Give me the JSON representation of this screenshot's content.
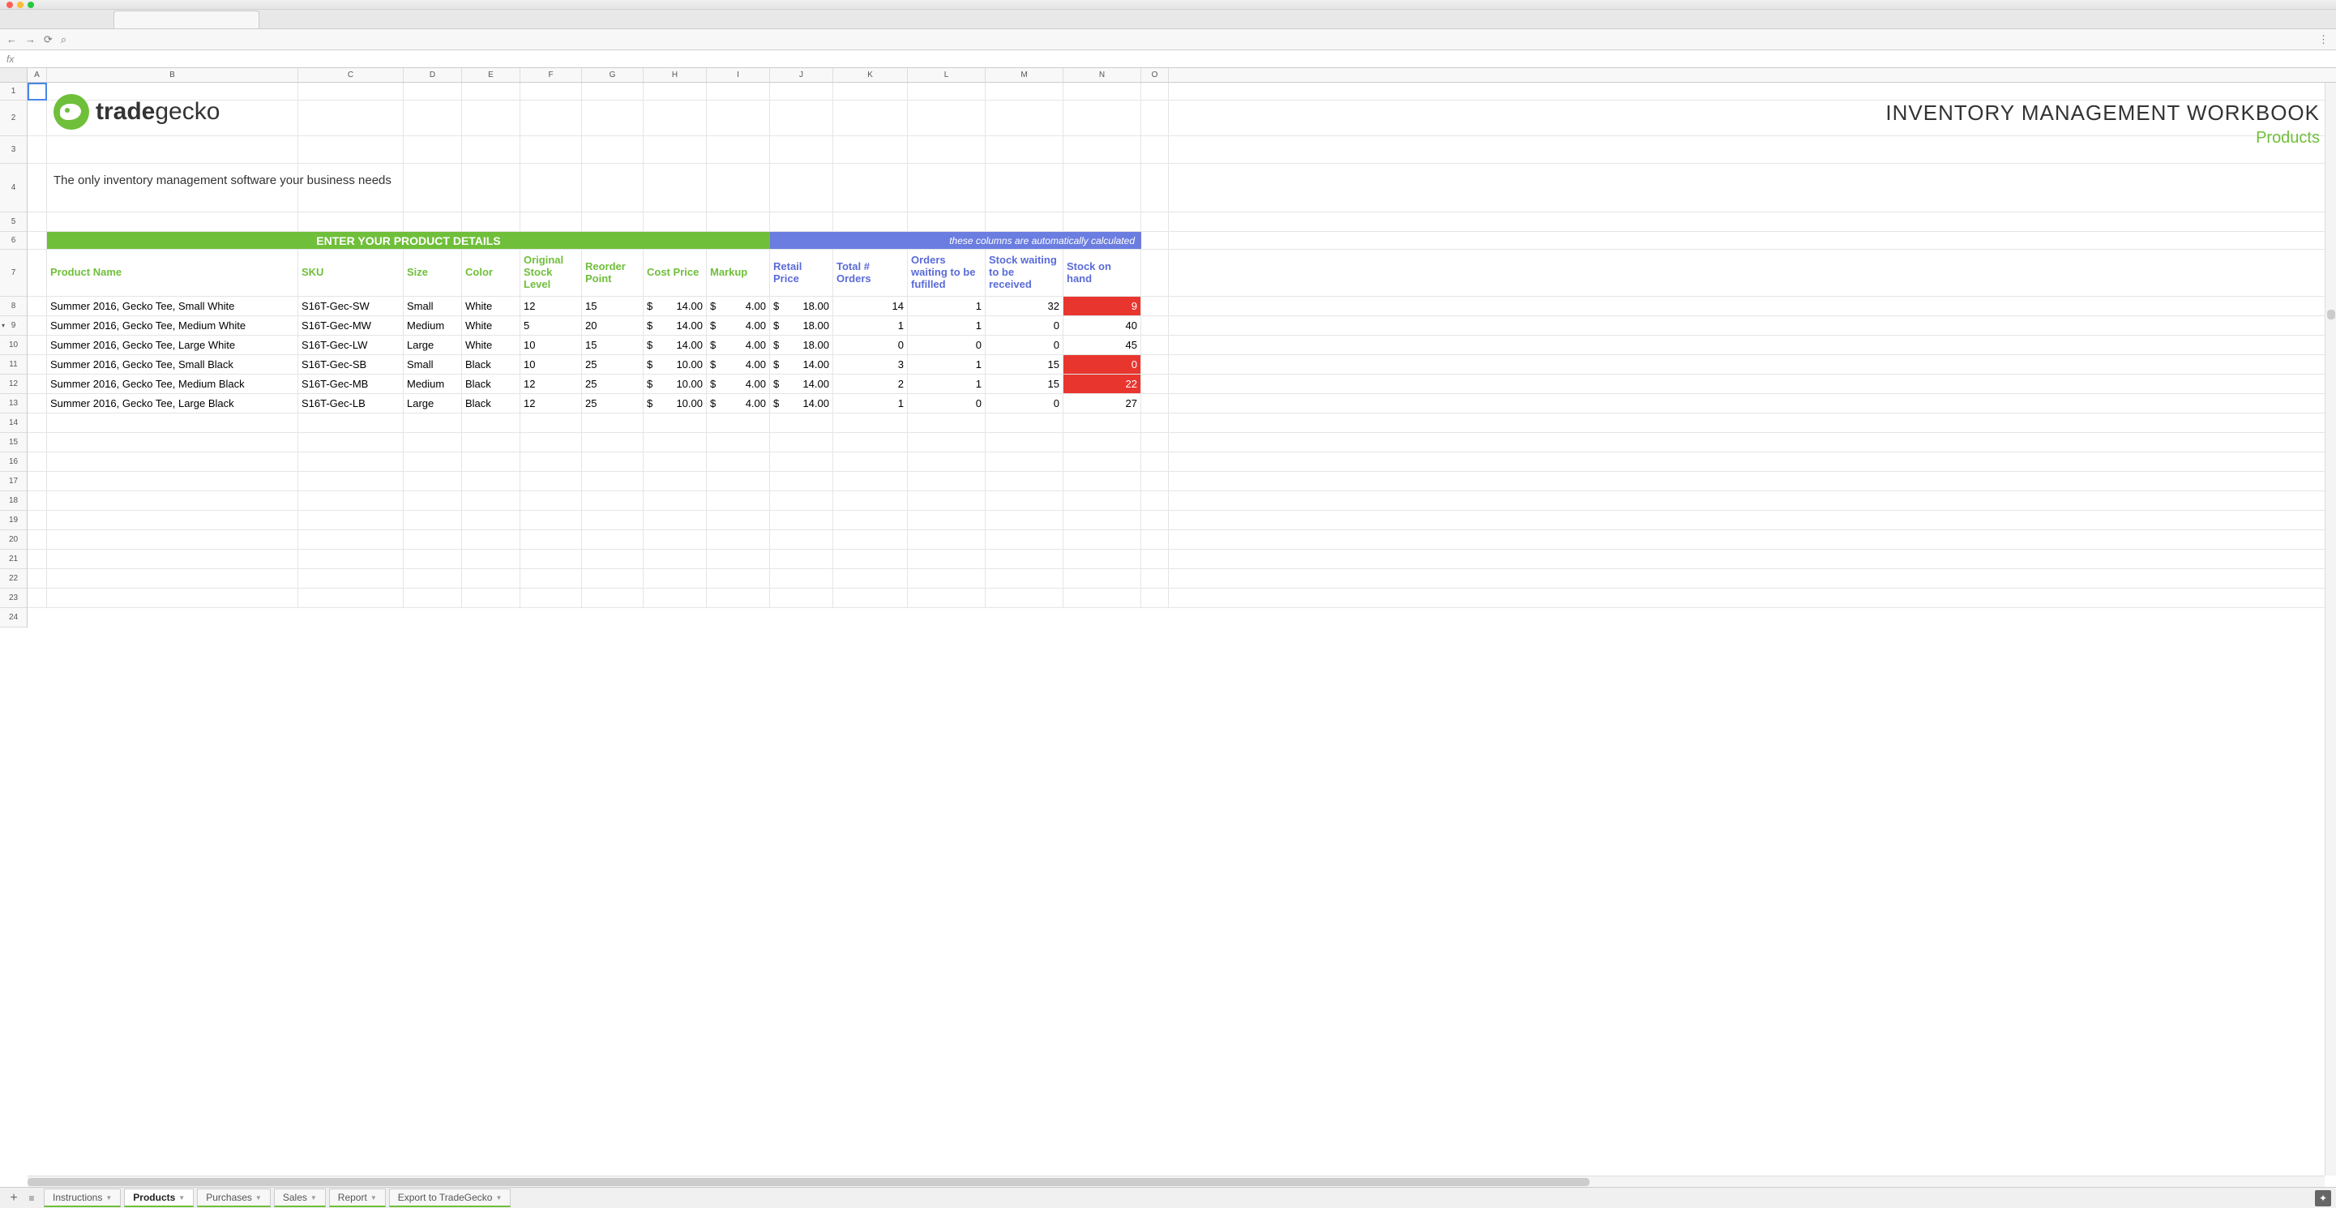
{
  "chrome": {
    "search_placeholder": ""
  },
  "fx_label": "fx",
  "columns": [
    "A",
    "B",
    "C",
    "D",
    "E",
    "F",
    "G",
    "H",
    "I",
    "J",
    "K",
    "L",
    "M",
    "N",
    "O"
  ],
  "row_numbers": [
    "1",
    "2",
    "3",
    "4",
    "5",
    "6",
    "7",
    "8",
    "9",
    "10",
    "11",
    "12",
    "13",
    "14",
    "15",
    "16",
    "17",
    "18",
    "19",
    "20",
    "21",
    "22",
    "23",
    "24"
  ],
  "logo": {
    "brand_a": "trade",
    "brand_b": "gecko"
  },
  "title": {
    "main": "INVENTORY MANAGEMENT  WORKBOOK",
    "sub": "Products"
  },
  "tagline": "The only inventory management software your business needs",
  "band": {
    "green": "ENTER YOUR PRODUCT DETAILS",
    "blue": "these  columns are automatically calculated"
  },
  "headers_green": {
    "name": "Product Name",
    "sku": "SKU",
    "size": "Size",
    "color": "Color",
    "osl": "Original Stock Level",
    "reorder": "Reorder Point",
    "cost": "Cost Price",
    "markup": "Markup"
  },
  "headers_blue": {
    "retail": "Retail Price",
    "orders": "Total # Orders",
    "wait_fulfill": "Orders waiting to be fufilled",
    "wait_receive": "Stock waiting to be received",
    "onhand": "Stock on hand"
  },
  "rows": [
    {
      "name": "Summer 2016, Gecko Tee, Small White",
      "sku": "S16T-Gec-SW",
      "size": "Small",
      "color": "White",
      "osl": "12",
      "reorder": "15",
      "cost": "14.00",
      "markup": "4.00",
      "retail": "18.00",
      "orders": "14",
      "wf": "1",
      "wr": "32",
      "onhand": "9",
      "alert": true
    },
    {
      "name": "Summer 2016, Gecko Tee, Medium White",
      "sku": "S16T-Gec-MW",
      "size": "Medium",
      "color": "White",
      "osl": "5",
      "reorder": "20",
      "cost": "14.00",
      "markup": "4.00",
      "retail": "18.00",
      "orders": "1",
      "wf": "1",
      "wr": "0",
      "onhand": "40",
      "alert": false
    },
    {
      "name": "Summer 2016, Gecko Tee, Large White",
      "sku": "S16T-Gec-LW",
      "size": "Large",
      "color": "White",
      "osl": "10",
      "reorder": "15",
      "cost": "14.00",
      "markup": "4.00",
      "retail": "18.00",
      "orders": "0",
      "wf": "0",
      "wr": "0",
      "onhand": "45",
      "alert": false
    },
    {
      "name": "Summer 2016, Gecko Tee, Small Black",
      "sku": "S16T-Gec-SB",
      "size": "Small",
      "color": "Black",
      "osl": "10",
      "reorder": "25",
      "cost": "10.00",
      "markup": "4.00",
      "retail": "14.00",
      "orders": "3",
      "wf": "1",
      "wr": "15",
      "onhand": "0",
      "alert": true
    },
    {
      "name": "Summer 2016, Gecko Tee, Medium Black",
      "sku": "S16T-Gec-MB",
      "size": "Medium",
      "color": "Black",
      "osl": "12",
      "reorder": "25",
      "cost": "10.00",
      "markup": "4.00",
      "retail": "14.00",
      "orders": "2",
      "wf": "1",
      "wr": "15",
      "onhand": "22",
      "alert": true
    },
    {
      "name": "Summer 2016, Gecko Tee, Large Black",
      "sku": "S16T-Gec-LB",
      "size": "Large",
      "color": "Black",
      "osl": "12",
      "reorder": "25",
      "cost": "10.00",
      "markup": "4.00",
      "retail": "14.00",
      "orders": "1",
      "wf": "0",
      "wr": "0",
      "onhand": "27",
      "alert": false
    }
  ],
  "tabs": [
    {
      "label": "Instructions",
      "active": false
    },
    {
      "label": "Products",
      "active": true
    },
    {
      "label": "Purchases",
      "active": false
    },
    {
      "label": "Sales",
      "active": false
    },
    {
      "label": "Report",
      "active": false
    },
    {
      "label": "Export to TradeGecko",
      "active": false
    }
  ]
}
